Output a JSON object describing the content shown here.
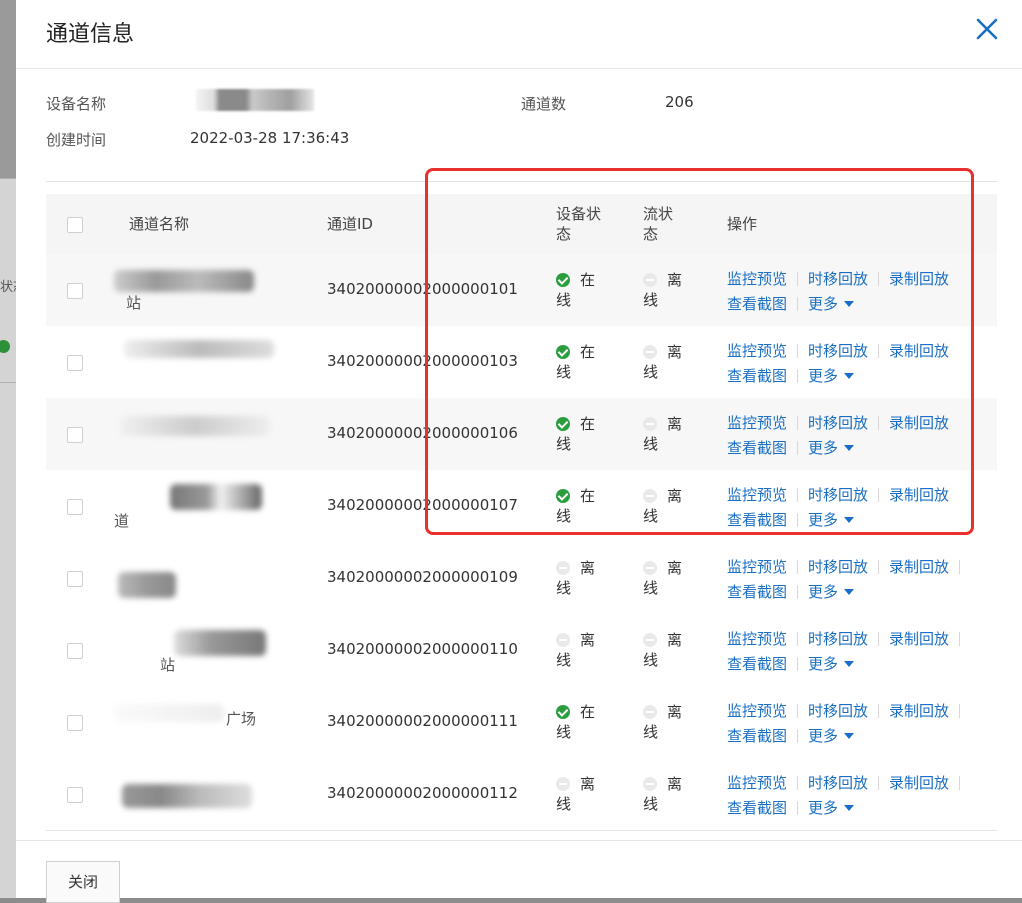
{
  "dialog": {
    "title": "通道信息",
    "close_button_label": "关闭"
  },
  "info": {
    "device_name_label": "设备名称",
    "channel_count_label": "通道数",
    "channel_count_value": "206",
    "created_time_label": "创建时间",
    "created_time_value": "2022-03-28 17:36:43"
  },
  "table": {
    "headers": {
      "channel_name": "通道名称",
      "channel_id": "通道ID",
      "device_status": "设备状态",
      "stream_status": "流状态",
      "actions": "操作"
    },
    "action_labels": {
      "live_preview": "监控预览",
      "timeshift_playback": "时移回放",
      "recording_playback": "录制回放",
      "view_screenshot": "查看截图",
      "more": "更多"
    },
    "rows": [
      {
        "visible_name": "站",
        "channel_id": "34020000002000000101",
        "device_status": "在线",
        "device_online": true,
        "stream_status": "离线"
      },
      {
        "visible_name": "",
        "channel_id": "34020000002000000103",
        "device_status": "在线",
        "device_online": true,
        "stream_status": "离线"
      },
      {
        "visible_name": "",
        "channel_id": "34020000002000000106",
        "device_status": "在线",
        "device_online": true,
        "stream_status": "离线"
      },
      {
        "visible_name": "道",
        "channel_id": "34020000002000000107",
        "device_status": "在线",
        "device_online": true,
        "stream_status": "离线"
      },
      {
        "visible_name": "",
        "channel_id": "34020000002000000109",
        "device_status": "离线",
        "device_online": false,
        "stream_status": "离线"
      },
      {
        "visible_name": "站",
        "channel_id": "34020000002000000110",
        "device_status": "离线",
        "device_online": false,
        "stream_status": "离线"
      },
      {
        "visible_name": "广场",
        "channel_id": "34020000002000000111",
        "device_status": "在线",
        "device_online": true,
        "stream_status": "离线"
      },
      {
        "visible_name": "",
        "channel_id": "34020000002000000112",
        "device_status": "离线",
        "device_online": false,
        "stream_status": "离线"
      }
    ]
  },
  "background_fragment": "状态",
  "colors": {
    "link": "#1a6fc4",
    "online": "#2a9d3c",
    "offline_icon": "#e9e9e9",
    "highlight_box": "#e8312f"
  }
}
